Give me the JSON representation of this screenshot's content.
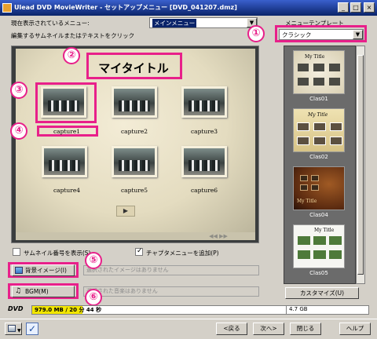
{
  "window": {
    "title": "Ulead DVD MovieWriter - セットアップメニュー [DVD_041207.dmz]",
    "min_label": "_",
    "max_label": "□",
    "close_label": "×"
  },
  "menu_selector": {
    "label": "現在表示されているメニュー:",
    "value": "メインメニュー"
  },
  "edit_hint": "編集するサムネイルまたはテキストをクリック",
  "menu_template": {
    "label": "メニューテンプレート",
    "value": "クラシック"
  },
  "preview": {
    "menu_title": "マイタイトル",
    "captions": [
      "capture1",
      "capture2",
      "capture3",
      "capture4",
      "capture5",
      "capture6"
    ],
    "next_button": "▶",
    "dim_nav": "◀◀ ▶▶"
  },
  "callouts": [
    "①",
    "②",
    "③",
    "④",
    "⑤",
    "⑥"
  ],
  "options": {
    "show_thumbnail_number": "サムネイル番号を表示(S)",
    "show_thumbnail_number_checked": false,
    "add_chapter_menu": "チャプタメニューを追加(P)",
    "add_chapter_menu_checked": true
  },
  "background": {
    "button": "背景イメージ(I)",
    "field": "選択されたイメージはありません"
  },
  "bgm": {
    "button": "BGM(M)",
    "field": "選択された音楽はありません"
  },
  "templates": [
    {
      "label": "Clas01",
      "card_title": "My Title"
    },
    {
      "label": "Clas02",
      "card_title": "My Title"
    },
    {
      "label": "Clas04",
      "card_title": "My Title"
    },
    {
      "label": "Clas05",
      "card_title": "My Title"
    }
  ],
  "customize_button": "カスタマイズ(U)",
  "capacity": {
    "disc": "DVD",
    "used": "979.0 MB / 20 分 44 秒",
    "max": "4.7 GB",
    "fraction": 0.2
  },
  "footer": {
    "back": "<戻る",
    "next": "次へ>",
    "close": "閉じる",
    "help": "ヘルプ"
  },
  "colors": {
    "callout": "#e8208a",
    "titlebar": "#0a246a",
    "capacity_fill": "#f2e600"
  }
}
